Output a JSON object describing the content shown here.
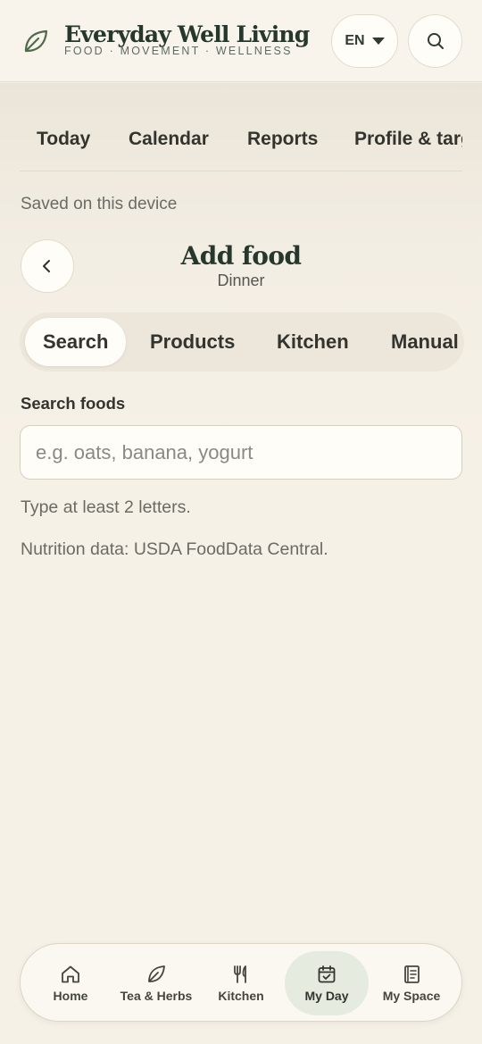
{
  "header": {
    "title": "Everyday Well Living",
    "tagline": "FOOD · MOVEMENT · WELLNESS",
    "language": "EN"
  },
  "topnav": {
    "items": [
      "Today",
      "Calendar",
      "Reports",
      "Profile & targ"
    ]
  },
  "status": {
    "saved_note": "Saved on this device"
  },
  "page": {
    "title": "Add food",
    "subtitle": "Dinner"
  },
  "segments": {
    "items": [
      "Search",
      "Products",
      "Kitchen",
      "Manual"
    ],
    "active": "Search"
  },
  "search": {
    "label": "Search foods",
    "placeholder": "e.g. oats, banana, yogurt",
    "value": "",
    "hint": "Type at least 2 letters.",
    "source": "Nutrition data: USDA FoodData Central."
  },
  "bottom_nav": {
    "items": [
      "Home",
      "Tea & Herbs",
      "Kitchen",
      "My Day",
      "My Space"
    ],
    "active": "My Day"
  },
  "colors": {
    "background": "#f6f1e7",
    "brand_green": "#26372b",
    "active_tab": "#e5ebdf"
  },
  "icons": {
    "logo": "leaf-icon",
    "language_caret": "caret-down-icon",
    "search": "search-icon",
    "back": "chevron-left-icon",
    "home": "home-icon",
    "tea": "leaf-icon",
    "kitchen": "fork-knife-icon",
    "my_day": "calendar-check-icon",
    "my_space": "notebook-icon"
  }
}
